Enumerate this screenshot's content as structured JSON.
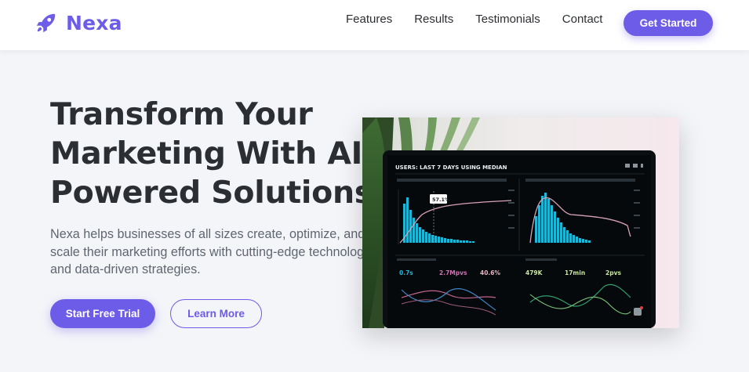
{
  "brand": {
    "name": "Nexa",
    "icon": "rocket-icon",
    "accent_color": "#6c5ce7"
  },
  "nav": {
    "links": [
      "Features",
      "Results",
      "Testimonials",
      "Contact"
    ],
    "cta_label": "Get Started"
  },
  "hero": {
    "title": "Transform Your Marketing With AI-Powered Solutions",
    "subtitle": "Nexa helps businesses of all sizes create, optimize, and scale their marketing efforts with cutting-edge technology and data-driven strategies.",
    "primary_button": "Start Free Trial",
    "secondary_button": "Learn More"
  },
  "dashboard_image": {
    "header": "USERS: LAST 7 DAYS USING MEDIAN",
    "tooltip_value": "57.1%",
    "metrics": [
      "0.7s",
      "2.7Mpvs",
      "40.6%",
      "479K",
      "17min",
      "2pvs"
    ]
  }
}
